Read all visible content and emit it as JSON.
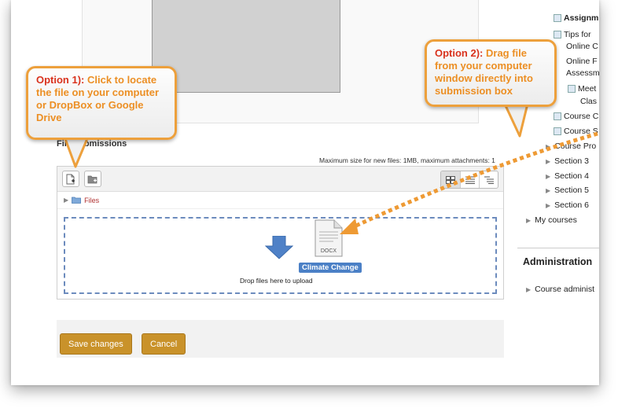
{
  "callouts": {
    "option1": {
      "label": "Option 1):",
      "text": " Click to locate the file on your computer or DropBox or Google Drive"
    },
    "option2": {
      "label": "Option 2):",
      "text": " Drag file from your computer window directly into submission box"
    }
  },
  "form": {
    "file_submissions_label": "File submissions",
    "max_size_text": "Maximum size for new files: 1MB, maximum attachments: 1",
    "path_folder": "Files",
    "drop_text": "Drop files here to upload",
    "dragged_file_type": "DOCX",
    "dragged_file_name": "Climate Change",
    "save_label": "Save changes",
    "cancel_label": "Cancel"
  },
  "sidebar": {
    "items": [
      "Assignm",
      "Tips for",
      "Online C",
      "Online F",
      "Assessm",
      "Meet",
      "Clas",
      "Course C",
      "Course S",
      "Course Pro",
      "Section 3",
      "Section 4",
      "Section 5",
      "Section 6",
      "My courses"
    ],
    "admin_title": "Administration",
    "admin_item": "Course administ"
  },
  "colors": {
    "callout_border": "#eda03c",
    "callout_text": "#ec8f24",
    "option_label": "#d9321d",
    "button": "#c9922a",
    "drop_border": "#6c8bbd"
  }
}
